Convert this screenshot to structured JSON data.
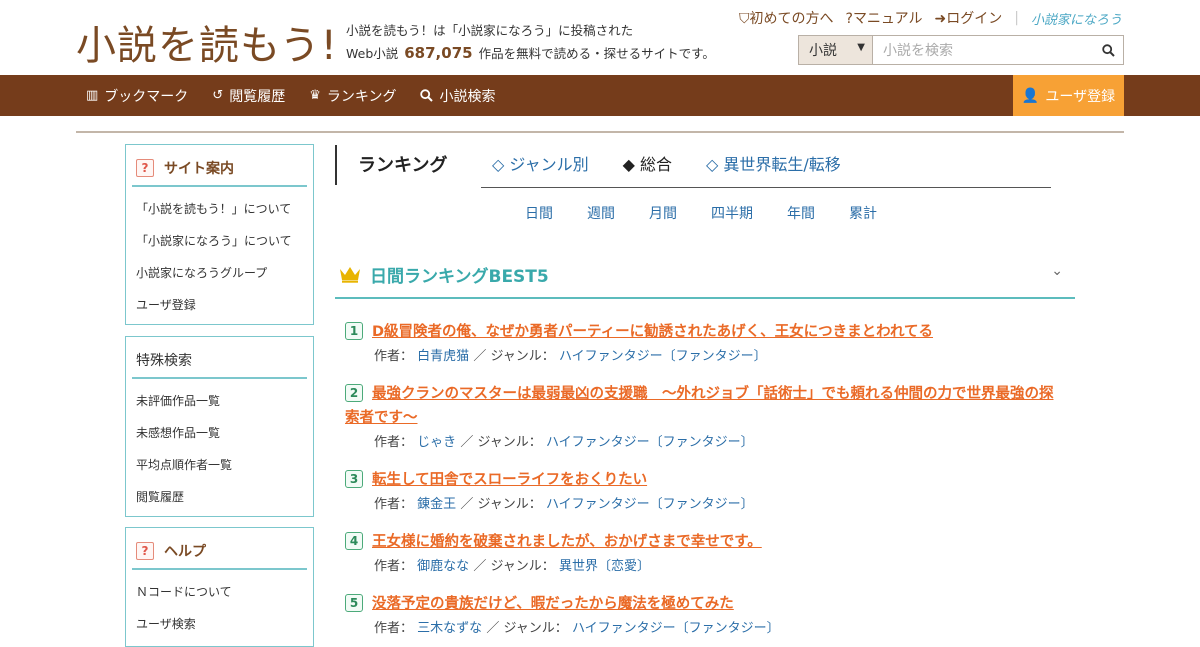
{
  "header": {
    "logo_text": "小説を読もう!",
    "tagline_line1": "小説を読もう！は「小説家になろう」に投稿された",
    "tagline_prefix": "Web小説",
    "work_count": "687,075",
    "tagline_suffix": "作品を無料で読める・探せるサイトです。",
    "links": [
      "初めての方へ",
      "マニュアル",
      "ログイン"
    ],
    "brand_small": "小説家になろう",
    "search": {
      "category": "小説",
      "placeholder": "小説を検索"
    }
  },
  "nav": {
    "items": [
      {
        "label": "ブックマーク",
        "icon": "bookmark-icon"
      },
      {
        "label": "閲覧履歴",
        "icon": "history-icon"
      },
      {
        "label": "ランキング",
        "icon": "crown-icon"
      },
      {
        "label": "小説検索",
        "icon": "search-icon"
      }
    ],
    "register_label": "ユーザ登録"
  },
  "sidebar": {
    "site_guide": {
      "title": "サイト案内",
      "items": [
        "「小説を読もう！」について",
        "「小説家になろう」について",
        "小説家になろうグループ",
        "ユーザ登録"
      ]
    },
    "special_search": {
      "title": "特殊検索",
      "items": [
        "未評価作品一覧",
        "未感想作品一覧",
        "平均点順作者一覧",
        "閲覧履歴"
      ]
    },
    "help": {
      "title": "ヘルプ",
      "items": [
        "Ｎコードについて",
        "ユーザ検索"
      ]
    }
  },
  "ranking": {
    "title": "ランキング",
    "tabs": [
      {
        "label": "◇ ジャンル別",
        "active": false
      },
      {
        "label": "◆ 総合",
        "active": true
      },
      {
        "label": "◇ 異世界転生/転移",
        "active": false
      }
    ],
    "periods": [
      "日間",
      "週間",
      "月間",
      "四半期",
      "年間",
      "累計"
    ],
    "best_title": "日間ランキングBEST5",
    "author_label": "作者：",
    "genre_label": "／ ジャンル：",
    "entries": [
      {
        "rank": "1",
        "title": "D級冒険者の俺、なぜか勇者パーティーに勧誘されたあげく、王女につきまとわれてる",
        "author": "白青虎猫",
        "genre": "ハイファンタジー〔ファンタジー〕"
      },
      {
        "rank": "2",
        "title": "最強クランのマスターは最弱最凶の支援職　～外れジョブ「話術士」でも頼れる仲間の力で世界最強の探索者です～",
        "author": "じゃき",
        "genre": "ハイファンタジー〔ファンタジー〕"
      },
      {
        "rank": "3",
        "title": "転生して田舎でスローライフをおくりたい",
        "author": "錬金王",
        "genre": "ハイファンタジー〔ファンタジー〕"
      },
      {
        "rank": "4",
        "title": "王女様に婚約を破棄されましたが、おかげさまで幸せです。",
        "author": "御鹿なな",
        "genre": "異世界〔恋愛〕"
      },
      {
        "rank": "5",
        "title": "没落予定の貴族だけど、暇だったから魔法を極めてみた",
        "author": "三木なずな",
        "genre": "ハイファンタジー〔ファンタジー〕"
      }
    ]
  }
}
